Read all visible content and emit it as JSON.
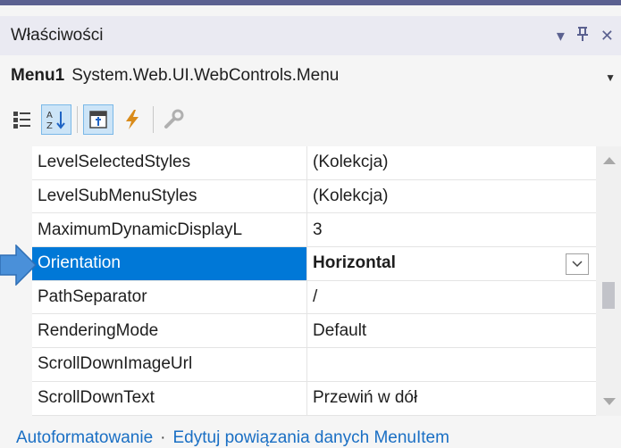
{
  "panel": {
    "title": "Właściwości",
    "tools": {
      "dropdown": "▾",
      "pin": "ꟸ",
      "close": "✕"
    }
  },
  "object": {
    "name": "Menu1",
    "type": "System.Web.UI.WebControls.Menu"
  },
  "toolbar": {
    "buttons": [
      "categorized-icon",
      "alphabetical-icon",
      "properties-icon",
      "events-icon",
      "property-pages-icon"
    ],
    "active": [
      "alphabetical-icon",
      "properties-icon"
    ]
  },
  "properties": [
    {
      "name": "LevelSelectedStyles",
      "value": "(Kolekcja)"
    },
    {
      "name": "LevelSubMenuStyles",
      "value": "(Kolekcja)"
    },
    {
      "name": "MaximumDynamicDisplayL",
      "value": "3"
    },
    {
      "name": "Orientation",
      "value": "Horizontal",
      "selected": true
    },
    {
      "name": "PathSeparator",
      "value": "/"
    },
    {
      "name": "RenderingMode",
      "value": "Default"
    },
    {
      "name": "ScrollDownImageUrl",
      "value": ""
    },
    {
      "name": "ScrollDownText",
      "value": "Przewiń w dół"
    }
  ],
  "commands": {
    "autoformat": "Autoformatowanie",
    "edit_bindings": "Edytuj powiązania danych MenuItem",
    "separator": "·"
  },
  "colors": {
    "accent": "#5b6190",
    "selection": "#0078d7",
    "arrow": "#4a90d9",
    "link": "#1a6fc4"
  }
}
